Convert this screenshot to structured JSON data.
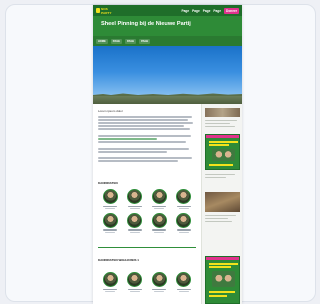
{
  "site": {
    "logo_text": "NOS PARTY",
    "title": "Sheel Pinning bij de Nieuwe Partij",
    "top_nav": [
      "Page",
      "Page",
      "Page",
      "Page"
    ],
    "top_cta": "Doneer",
    "sub_nav": [
      "HOME",
      "PAGE",
      "PAGE",
      "PAGE"
    ]
  },
  "main": {
    "intro_heading": "Lorem ipsum dolor",
    "section_one_title": "KANDIDATEN",
    "section_two_title": "KANDIDATEN WAHLKREIS 1"
  },
  "colors": {
    "brand_green": "#2e8b37",
    "dark_green": "#1f6e2a",
    "accent_pink": "#e0338d",
    "accent_yellow": "#f2e21c"
  }
}
